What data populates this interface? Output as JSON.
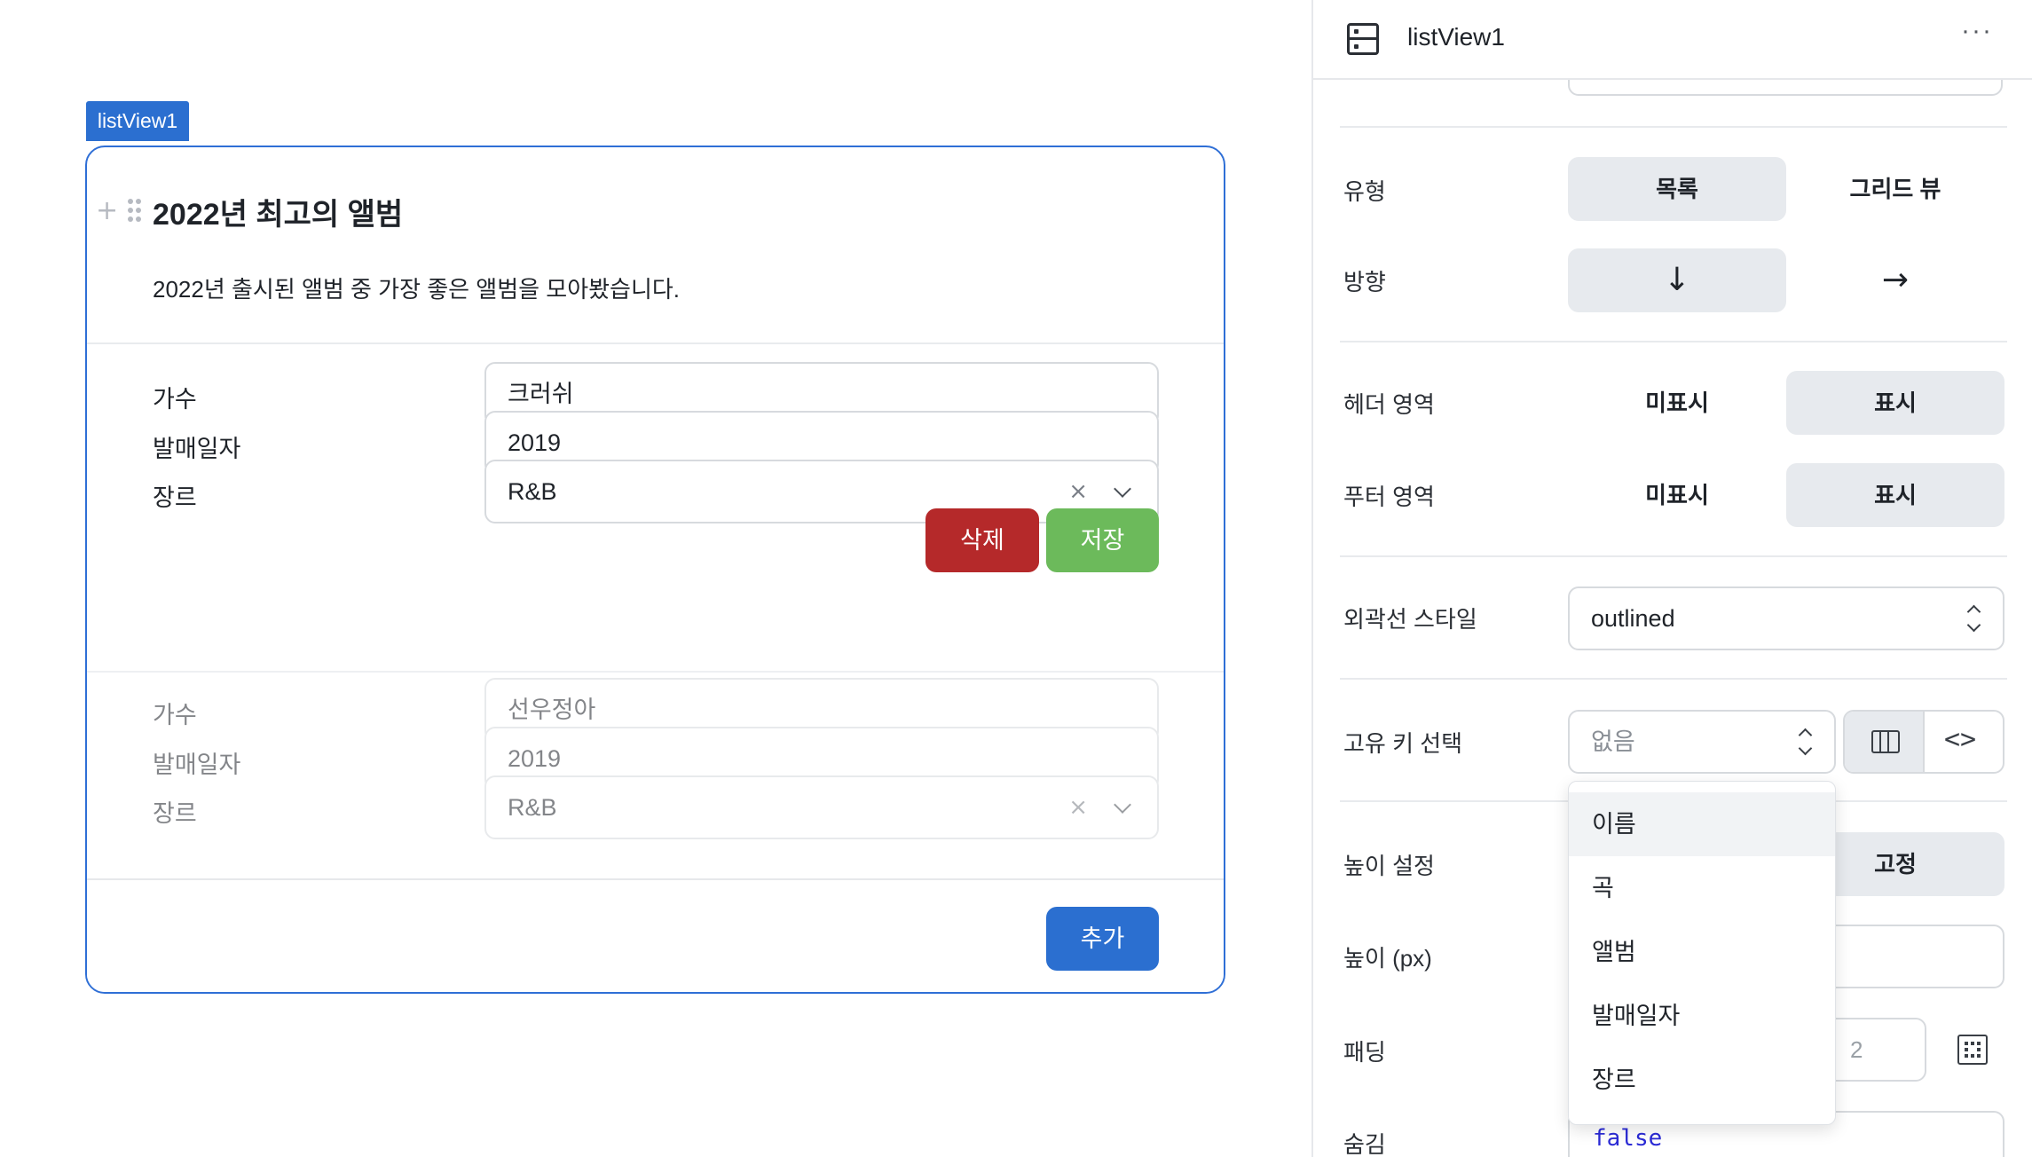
{
  "canvas": {
    "component_tag": "listView1",
    "header": {
      "title": "2022년 최고의 앨범",
      "description": "2022년 출시된 앨범 중 가장 좋은 앨범을 모아봤습니다."
    },
    "items": [
      {
        "singer_label": "가수",
        "singer": "크러쉬",
        "date_label": "발매일자",
        "date": "2019",
        "genre_label": "장르",
        "genre": "R&B"
      },
      {
        "singer_label": "가수",
        "singer": "선우정아",
        "date_label": "발매일자",
        "date": "2019",
        "genre_label": "장르",
        "genre": "R&B"
      }
    ],
    "delete_label": "삭제",
    "save_label": "저장",
    "add_label": "추가",
    "clear_glyph": "×",
    "plus_glyph": "+"
  },
  "panel": {
    "title": "listView1",
    "more": "···",
    "type": {
      "label": "유형",
      "options": [
        "목록",
        "그리드 뷰"
      ],
      "selected": "목록"
    },
    "direction": {
      "label": "방향",
      "options": [
        "↓",
        "→"
      ],
      "selected": "↓"
    },
    "header_area": {
      "label": "헤더 영역",
      "options": [
        "미표시",
        "표시"
      ],
      "selected": "표시"
    },
    "footer_area": {
      "label": "푸터 영역",
      "options": [
        "미표시",
        "표시"
      ],
      "selected": "표시"
    },
    "border_style": {
      "label": "외곽선 스타일",
      "value": "outlined"
    },
    "unique_key": {
      "label": "고유 키 선택",
      "value": "없음",
      "options": [
        "이름",
        "곡",
        "앨범",
        "발매일자",
        "장르"
      ],
      "code_glyph": "<>"
    },
    "height_setting": {
      "label": "높이 설정",
      "visible_option": "고정"
    },
    "height_px": {
      "label": "높이 (px)"
    },
    "padding": {
      "label": "패딩",
      "value": "2"
    },
    "hidden": {
      "label": "숨김",
      "value": "false"
    }
  },
  "colors": {
    "accent": "#2b6fd0",
    "danger": "#b5292a",
    "success": "#6cba5b"
  }
}
